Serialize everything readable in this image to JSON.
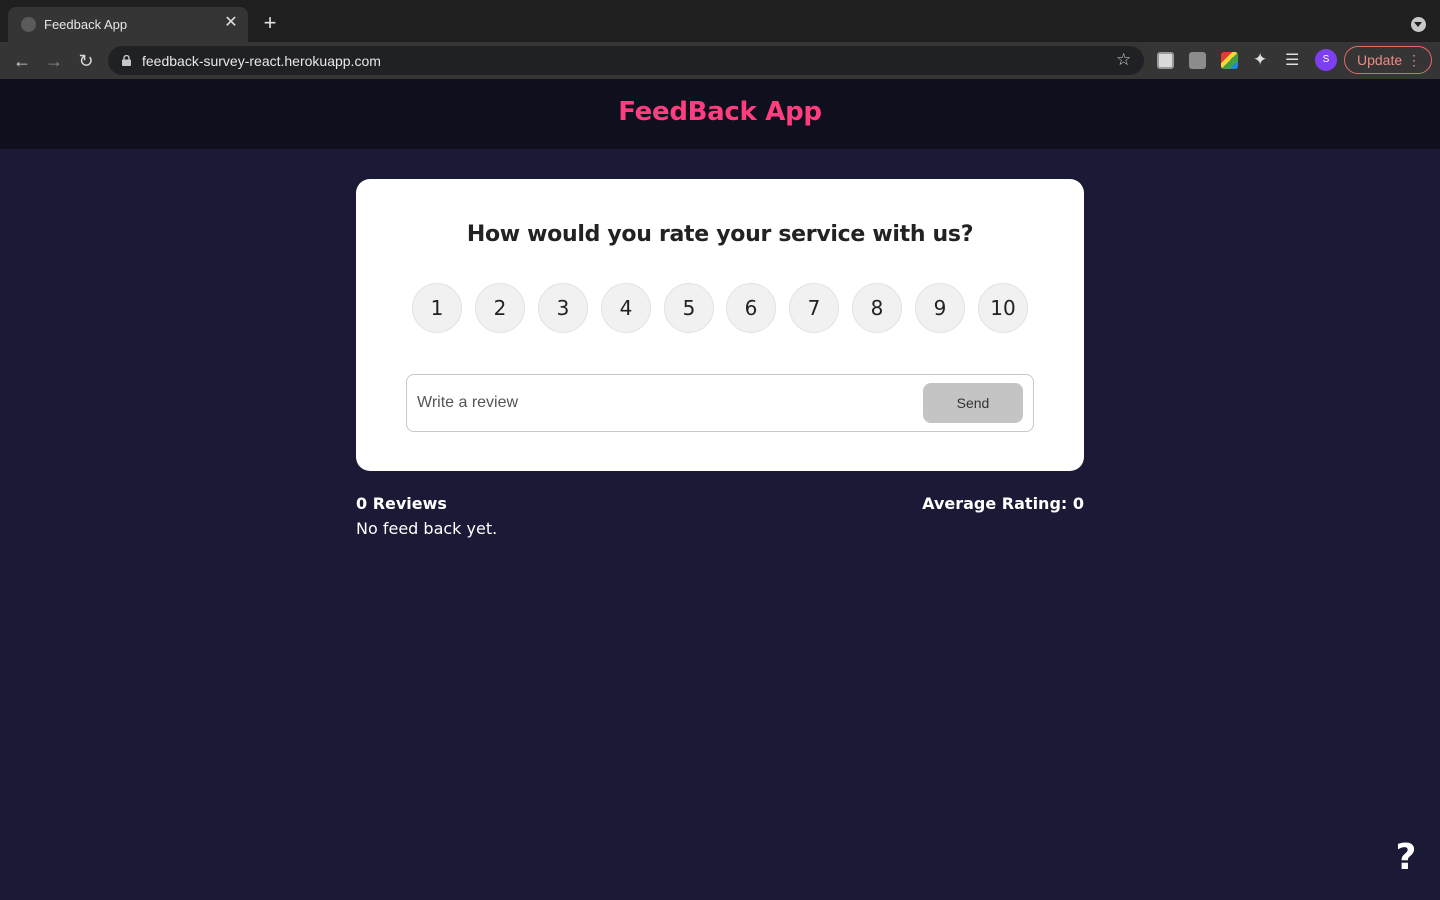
{
  "browser": {
    "tab_title": "Feedback App",
    "tab_close_glyph": "✕",
    "new_tab_glyph": "+",
    "url": "feedback-survey-react.herokuapp.com",
    "avatar_initial": "S",
    "update_label": "Update",
    "icons": [
      "globe-icon",
      "close-icon",
      "plus-icon",
      "back-arrow-icon",
      "forward-arrow-icon",
      "reload-icon",
      "lock-icon",
      "star-icon",
      "puzzle-icon",
      "media-icon",
      "more-vert-icon",
      "chevron-down-icon"
    ]
  },
  "app": {
    "title": "FeedBack App",
    "accent_color": "#ff3d7f",
    "background_color": "#1a1936"
  },
  "card": {
    "question": "How would you rate your service with us?",
    "ratings": [
      "1",
      "2",
      "3",
      "4",
      "5",
      "6",
      "7",
      "8",
      "9",
      "10"
    ],
    "review_placeholder": "Write a review",
    "review_value": "",
    "send_label": "Send"
  },
  "stats": {
    "count_label": "0 Reviews",
    "average_label": "Average Rating: 0",
    "empty_message": "No feed back yet."
  },
  "help": {
    "glyph": "?"
  }
}
